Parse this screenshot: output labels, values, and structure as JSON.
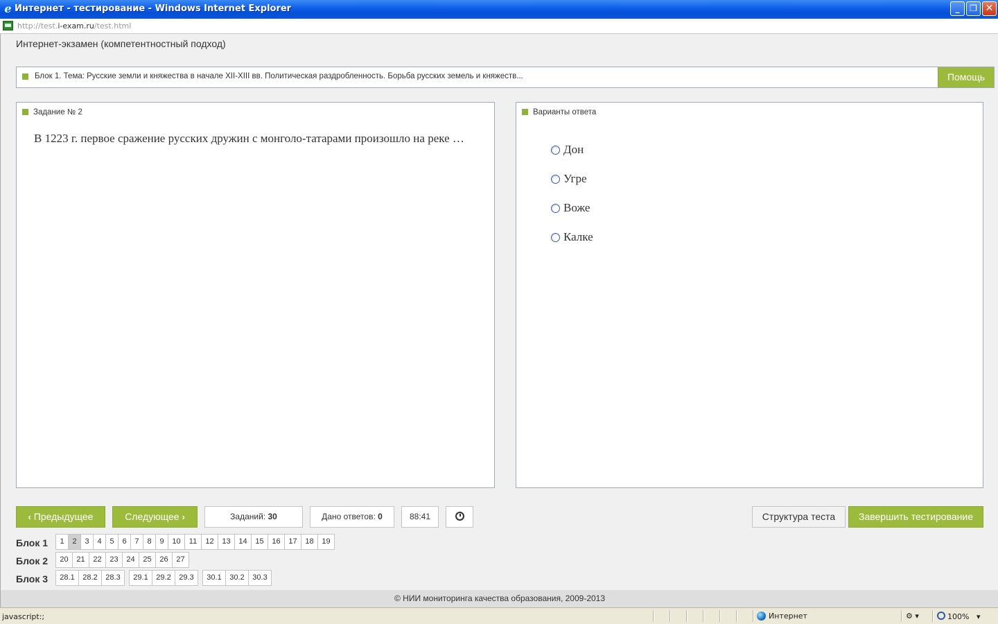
{
  "window": {
    "title": "Интернет - тестирование - Windows Internet Explorer",
    "min_glyph": "_",
    "max_glyph": "❐",
    "close_glyph": "✕"
  },
  "address": {
    "url_prefix": "http://test.",
    "url_domain": "i-exam.ru",
    "url_suffix": "/test.html"
  },
  "page": {
    "heading": "Интернет-экзамен (компетентностный подход)",
    "block_topic": "Блок 1. Тема: Русские земли и княжества в начале XII-XIII вв. Политическая раздробленность. Борьба русских земель и княжеств...",
    "help_label": "Помощь"
  },
  "task": {
    "header": "Задание № 2",
    "question": "В 1223 г. первое сражение русских дружин с монголо-татарами произошло на реке …"
  },
  "answers": {
    "header": "Варианты ответа",
    "options": [
      "Дон",
      "Угре",
      "Воже",
      "Калке"
    ],
    "selected": null
  },
  "controls": {
    "prev_label": "Предыдущее",
    "next_label": "Следующее",
    "tasks_label": "Заданий:",
    "tasks_count": "30",
    "answered_label": "Дано ответов:",
    "answered_count": "0",
    "timer": "88:41",
    "structure_label": "Структура теста",
    "finish_label": "Завершить тестирование"
  },
  "blocks": [
    {
      "label": "Блок 1",
      "groups": [
        [
          "1",
          "2",
          "3",
          "4",
          "5",
          "6",
          "7",
          "8",
          "9",
          "10",
          "11",
          "12",
          "13",
          "14",
          "15",
          "16",
          "17",
          "18",
          "19"
        ]
      ],
      "active": "2"
    },
    {
      "label": "Блок 2",
      "groups": [
        [
          "20",
          "21",
          "22",
          "23",
          "24",
          "25",
          "26",
          "27"
        ]
      ],
      "active": null
    },
    {
      "label": "Блок 3",
      "groups": [
        [
          "28.1",
          "28.2",
          "28.3"
        ],
        [
          "29.1",
          "29.2",
          "29.3"
        ],
        [
          "30.1",
          "30.2",
          "30.3"
        ]
      ],
      "active": null
    }
  ],
  "footer": "© НИИ мониторинга качества образования, 2009-2013",
  "status": {
    "text": "javascript:;",
    "zone": "Интернет",
    "zoom": "100%"
  },
  "colors": {
    "accent_green": "#9cbb3c",
    "titlebar_blue": "#0a55df",
    "panel_border": "#9fa8c6"
  }
}
